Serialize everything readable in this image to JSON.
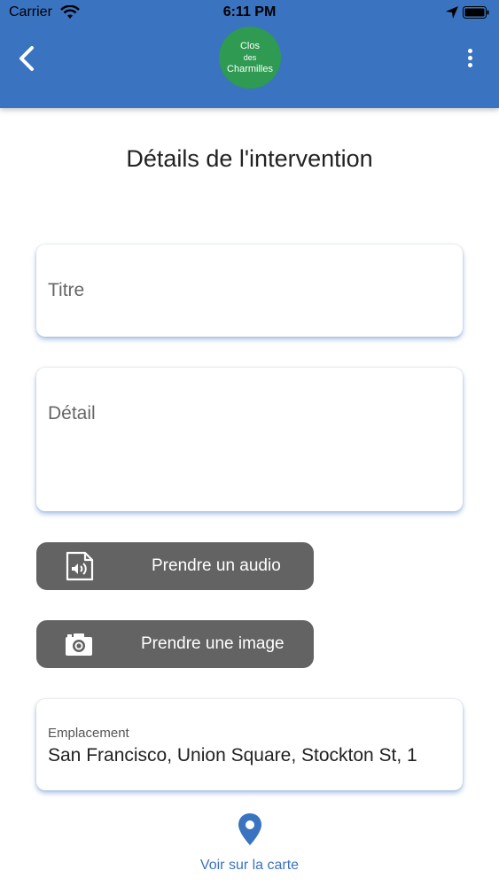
{
  "status_bar": {
    "carrier": "Carrier",
    "time": "6:11 PM"
  },
  "header": {
    "logo_line1": "Clos",
    "logo_line2": "des",
    "logo_line3": "Charmilles",
    "background_color": "#3a73c0",
    "logo_color": "#2e9a52"
  },
  "page": {
    "title": "Détails de l'intervention"
  },
  "form": {
    "titre_placeholder": "Titre",
    "detail_placeholder": "Détail",
    "audio_button_label": "Prendre un audio",
    "image_button_label": "Prendre une image",
    "location_label": "Emplacement",
    "location_value": "San Francisco, Union Square, Stockton St, 1",
    "map_link_label": "Voir sur la carte"
  },
  "icons": {
    "back": "chevron-left-icon",
    "menu": "more-vertical-icon",
    "audio": "audio-file-icon",
    "camera": "camera-icon",
    "map_pin": "map-pin-icon"
  }
}
